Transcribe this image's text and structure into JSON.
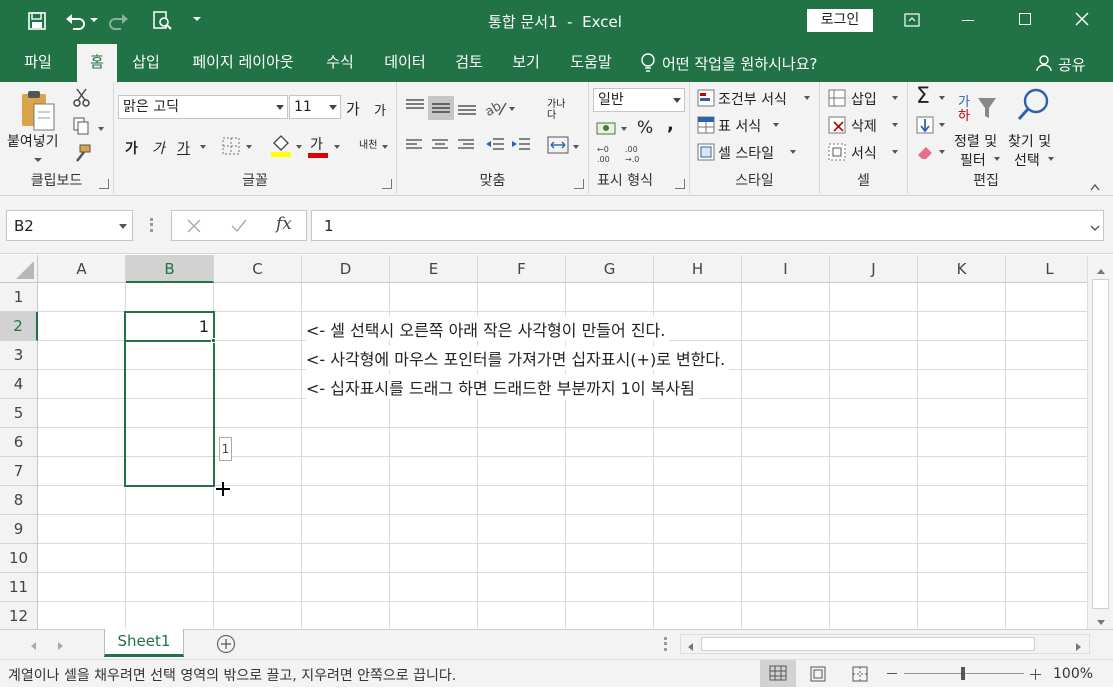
{
  "window": {
    "title": "통합 문서1  -  Excel",
    "login_label": "로그인",
    "colors": {
      "brand": "#217346",
      "selection": "#217346"
    }
  },
  "tabs": [
    {
      "label": "파일"
    },
    {
      "label": "홈"
    },
    {
      "label": "삽입"
    },
    {
      "label": "페이지 레이아웃"
    },
    {
      "label": "수식"
    },
    {
      "label": "데이터"
    },
    {
      "label": "검토"
    },
    {
      "label": "보기"
    },
    {
      "label": "도움말"
    }
  ],
  "tell_me": "어떤 작업을 원하시나요?",
  "share_label": "공유",
  "ribbon": {
    "clipboard": {
      "label": "클립보드",
      "paste": "붙여넣기"
    },
    "font": {
      "label": "글꼴",
      "name": "맑은 고딕",
      "size": "11",
      "grow": "가",
      "shrink": "가",
      "bold": "가",
      "italic": "가",
      "underline": "가",
      "color_a": "가",
      "phonetic": "내천"
    },
    "alignment": {
      "label": "맞춤",
      "wrap": "가나다"
    },
    "number": {
      "label": "표시 형식",
      "format": "일반",
      "percent": "%",
      "comma": ","
    },
    "styles": {
      "label": "스타일",
      "conditional": "조건부 서식",
      "table": "표 서식",
      "cell": "셀 스타일"
    },
    "cells": {
      "label": "셀",
      "insert": "삽입",
      "delete": "삭제",
      "format": "서식"
    },
    "editing": {
      "label": "편집",
      "sort_line1": "정렬 및",
      "sort_line2": "필터",
      "find_line1": "찾기 및",
      "find_line2": "선택"
    }
  },
  "formula_bar": {
    "name_box": "B2",
    "value": "1",
    "fx": "fx"
  },
  "columns": [
    "A",
    "B",
    "C",
    "D",
    "E",
    "F",
    "G",
    "H",
    "I",
    "J",
    "K",
    "L"
  ],
  "rows": [
    "1",
    "2",
    "3",
    "4",
    "5",
    "6",
    "7",
    "8",
    "9",
    "10",
    "11",
    "12"
  ],
  "cells": {
    "B2": "1",
    "D2": "<- 셀 선택시 오른쪽 아래 작은 사각형이 만들어 진다.",
    "D3": "<- 사각형에 마우스 포인터를 가져가면 십자표시(+)로 변한다.",
    "D4": "<- 십자표시를 드래그 하면 드래드한 부분까지 1이 복사됨"
  },
  "fill_tooltip": "1",
  "sheet_tab": "Sheet1",
  "status": {
    "message": "계열이나 셀을 채우려면 선택 영역의 밖으로 끌고, 지우려면 안쪽으로 끕니다.",
    "zoom": "100%"
  }
}
